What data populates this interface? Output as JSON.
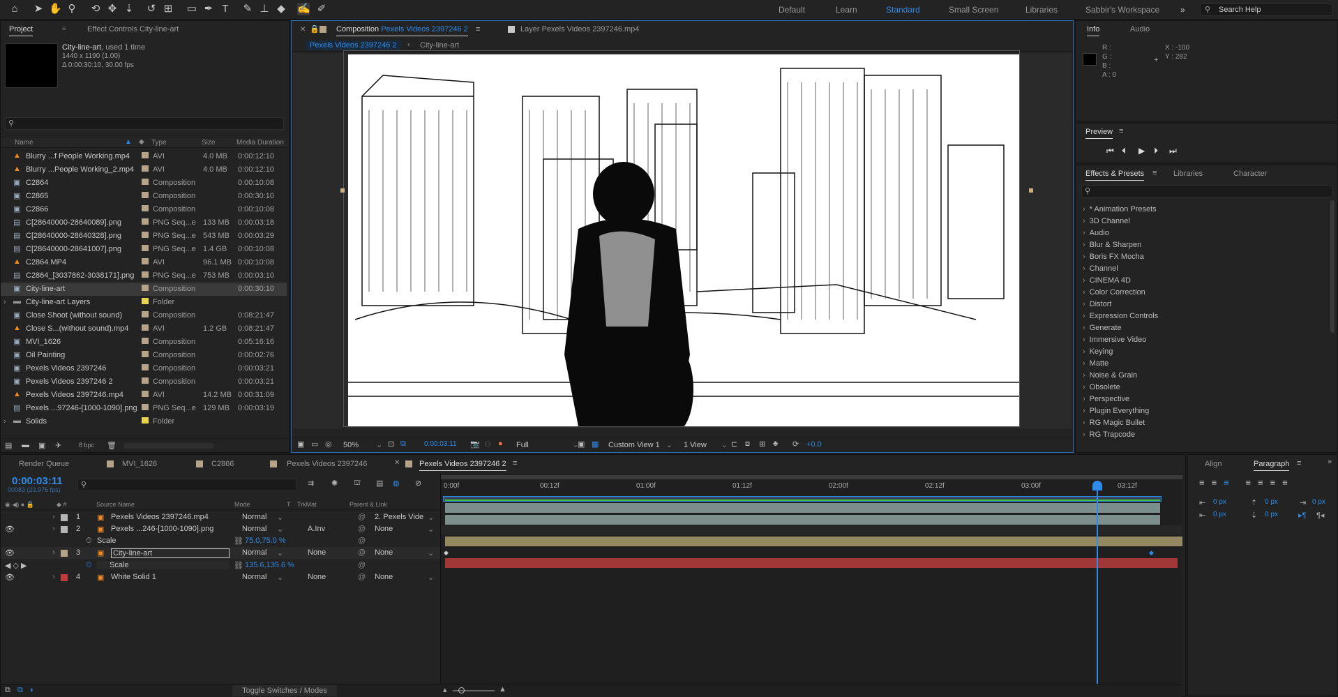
{
  "workspaces": [
    "Default",
    "Learn",
    "Standard",
    "Small Screen",
    "Libraries",
    "Sabbir's Workspace"
  ],
  "workspace_active": "Standard",
  "search_help_placeholder": "Search Help",
  "project": {
    "tabs": [
      "Project",
      "Effect Controls City-line-art"
    ],
    "item_name": "City-line-art",
    "item_used": ", used 1 time",
    "item_dims": "1440 x 1190 (1.00)",
    "item_duration": "Δ 0:00:30:10, 30.00 fps",
    "columns": [
      "Name",
      "Type",
      "Size",
      "Media Duration"
    ],
    "items": [
      {
        "name": "Blurry ...f People Working.mp4",
        "type": "AVI",
        "size": "4.0 MB",
        "dur": "0:00:12:10",
        "icon": "vlc-icon",
        "label": "#b5a48a"
      },
      {
        "name": "Blurry ...People Working_2.mp4",
        "type": "AVI",
        "size": "4.0 MB",
        "dur": "0:00:12:10",
        "icon": "vlc-icon",
        "label": "#b5a48a"
      },
      {
        "name": "C2864",
        "type": "Composition",
        "size": "",
        "dur": "0:00:10:08",
        "icon": "comp-icon",
        "label": "#b5a48a"
      },
      {
        "name": "C2865",
        "type": "Composition",
        "size": "",
        "dur": "0:00:30:10",
        "icon": "comp-icon",
        "label": "#b5a48a"
      },
      {
        "name": "C2866",
        "type": "Composition",
        "size": "",
        "dur": "0:00:10:08",
        "icon": "comp-icon",
        "label": "#b5a48a"
      },
      {
        "name": "C[28640000-28640089].png",
        "type": "PNG Seq...e",
        "size": "133 MB",
        "dur": "0:00:03:18",
        "icon": "png-seq-icon",
        "label": "#b5a48a"
      },
      {
        "name": "C[28640000-28640328].png",
        "type": "PNG Seq...e",
        "size": "543 MB",
        "dur": "0:00:03:29",
        "icon": "png-seq-icon",
        "label": "#b5a48a"
      },
      {
        "name": "C[28640000-28641007].png",
        "type": "PNG Seq...e",
        "size": "1.4 GB",
        "dur": "0:00:10:08",
        "icon": "png-seq-icon",
        "label": "#b5a48a"
      },
      {
        "name": "C2864.MP4",
        "type": "AVI",
        "size": "96.1 MB",
        "dur": "0:00:10:08",
        "icon": "vlc-icon",
        "label": "#b5a48a"
      },
      {
        "name": "C2864_[3037862-3038171].png",
        "type": "PNG Seq...e",
        "size": "753 MB",
        "dur": "0:00:03:10",
        "icon": "png-seq-icon",
        "label": "#b5a48a"
      },
      {
        "name": "City-line-art",
        "type": "Composition",
        "size": "",
        "dur": "0:00:30:10",
        "icon": "comp-icon",
        "label": "#b5a48a",
        "selected": true
      },
      {
        "name": "City-line-art Layers",
        "type": "Folder",
        "size": "",
        "dur": "",
        "icon": "folder-icon",
        "label": "#e8d44d",
        "folder": true
      },
      {
        "name": "Close Shoot (without sound)",
        "type": "Composition",
        "size": "",
        "dur": "0:08:21:47",
        "icon": "comp-icon",
        "label": "#b5a48a"
      },
      {
        "name": "Close S...(without sound).mp4",
        "type": "AVI",
        "size": "1.2 GB",
        "dur": "0:08:21:47",
        "icon": "vlc-icon",
        "label": "#b5a48a"
      },
      {
        "name": "MVI_1626",
        "type": "Composition",
        "size": "",
        "dur": "0:05:16:16",
        "icon": "comp-icon",
        "label": "#b5a48a"
      },
      {
        "name": "Oil Painting",
        "type": "Composition",
        "size": "",
        "dur": "0:00:02:76",
        "icon": "comp-icon",
        "label": "#b5a48a"
      },
      {
        "name": "Pexels Videos 2397246",
        "type": "Composition",
        "size": "",
        "dur": "0:00:03:21",
        "icon": "comp-icon",
        "label": "#b5a48a"
      },
      {
        "name": "Pexels Videos 2397246 2",
        "type": "Composition",
        "size": "",
        "dur": "0:00:03:21",
        "icon": "comp-icon",
        "label": "#b5a48a"
      },
      {
        "name": "Pexels Videos 2397246.mp4",
        "type": "AVI",
        "size": "14.2 MB",
        "dur": "0:00:31:09",
        "icon": "vlc-icon",
        "label": "#b5a48a"
      },
      {
        "name": "Pexels ...97246-[1000-1090].png",
        "type": "PNG Seq...e",
        "size": "129 MB",
        "dur": "0:00:03:19",
        "icon": "png-seq-icon",
        "label": "#b5a48a"
      },
      {
        "name": "Solids",
        "type": "Folder",
        "size": "",
        "dur": "",
        "icon": "folder-icon",
        "label": "#e8d44d",
        "folder": true
      }
    ],
    "bpc": "8 bpc"
  },
  "composition": {
    "tab_label": "Composition",
    "tab_name": "Pexels Videos 2397246 2",
    "layer_tab": "Layer Pexels Videos 2397246.mp4",
    "breadcrumb": [
      "Pexels Videos 2397246 2",
      "City-line-art"
    ],
    "zoom": "50%",
    "timecode": "0:00:03:11",
    "resolution": "Full",
    "view": "Custom View 1",
    "views": "1 View",
    "exposure": "+0.0"
  },
  "info": {
    "tabs": [
      "Info",
      "Audio"
    ],
    "r": "R :",
    "g": "G :",
    "b": "B :",
    "a": "A :  0",
    "x": "X : -100",
    "y": "Y : 282"
  },
  "preview": {
    "title": "Preview"
  },
  "effects": {
    "tabs": [
      "Effects & Presets",
      "Libraries",
      "Character"
    ],
    "items": [
      "* Animation Presets",
      "3D Channel",
      "Audio",
      "Blur & Sharpen",
      "Boris FX Mocha",
      "Channel",
      "CINEMA 4D",
      "Color Correction",
      "Distort",
      "Expression Controls",
      "Generate",
      "Immersive Video",
      "Keying",
      "Matte",
      "Noise & Grain",
      "Obsolete",
      "Perspective",
      "Plugin Everything",
      "RG Magic Bullet",
      "RG Trapcode"
    ]
  },
  "timeline": {
    "tabs": [
      "Render Queue",
      "MVI_1626",
      "C2866",
      "Pexels Videos 2397246",
      "Pexels Videos 2397246 2"
    ],
    "timecode": "0:00:03:11",
    "frame_info": "00083 (23.976 fps)",
    "columns": [
      "Source Name",
      "Mode",
      "T",
      "TrkMat",
      "Parent & Link"
    ],
    "ruler": [
      "0:00f",
      "00:12f",
      "01:00f",
      "01:12f",
      "02:00f",
      "02:12f",
      "03:00f",
      "03:12f"
    ],
    "layers": [
      {
        "num": "1",
        "name": "Pexels Videos 2397246.mp4",
        "mode": "Normal",
        "trkmat": "",
        "parent": "2. Pexels Vide",
        "label": "#b5b5b5"
      },
      {
        "num": "2",
        "name": "Pexels ...246-[1000-1090].png",
        "mode": "Normal",
        "trkmat": "A.Inv",
        "parent": "None",
        "label": "#b5b5b5"
      },
      {
        "prop": "Scale",
        "value": "75.0,75.0 %"
      },
      {
        "num": "3",
        "name": "City-line-art",
        "mode": "Normal",
        "trkmat": "None",
        "parent": "None",
        "label": "#b5a48a"
      },
      {
        "prop": "Scale",
        "value": "135.6,135.6 %"
      },
      {
        "num": "4",
        "name": "White Solid 1",
        "mode": "Normal",
        "trkmat": "None",
        "parent": "None",
        "label": "#c03c3c"
      }
    ],
    "toggle_label": "Toggle Switches / Modes"
  },
  "paragraph": {
    "tabs": [
      "Align",
      "Paragraph"
    ],
    "px": "0 px"
  }
}
